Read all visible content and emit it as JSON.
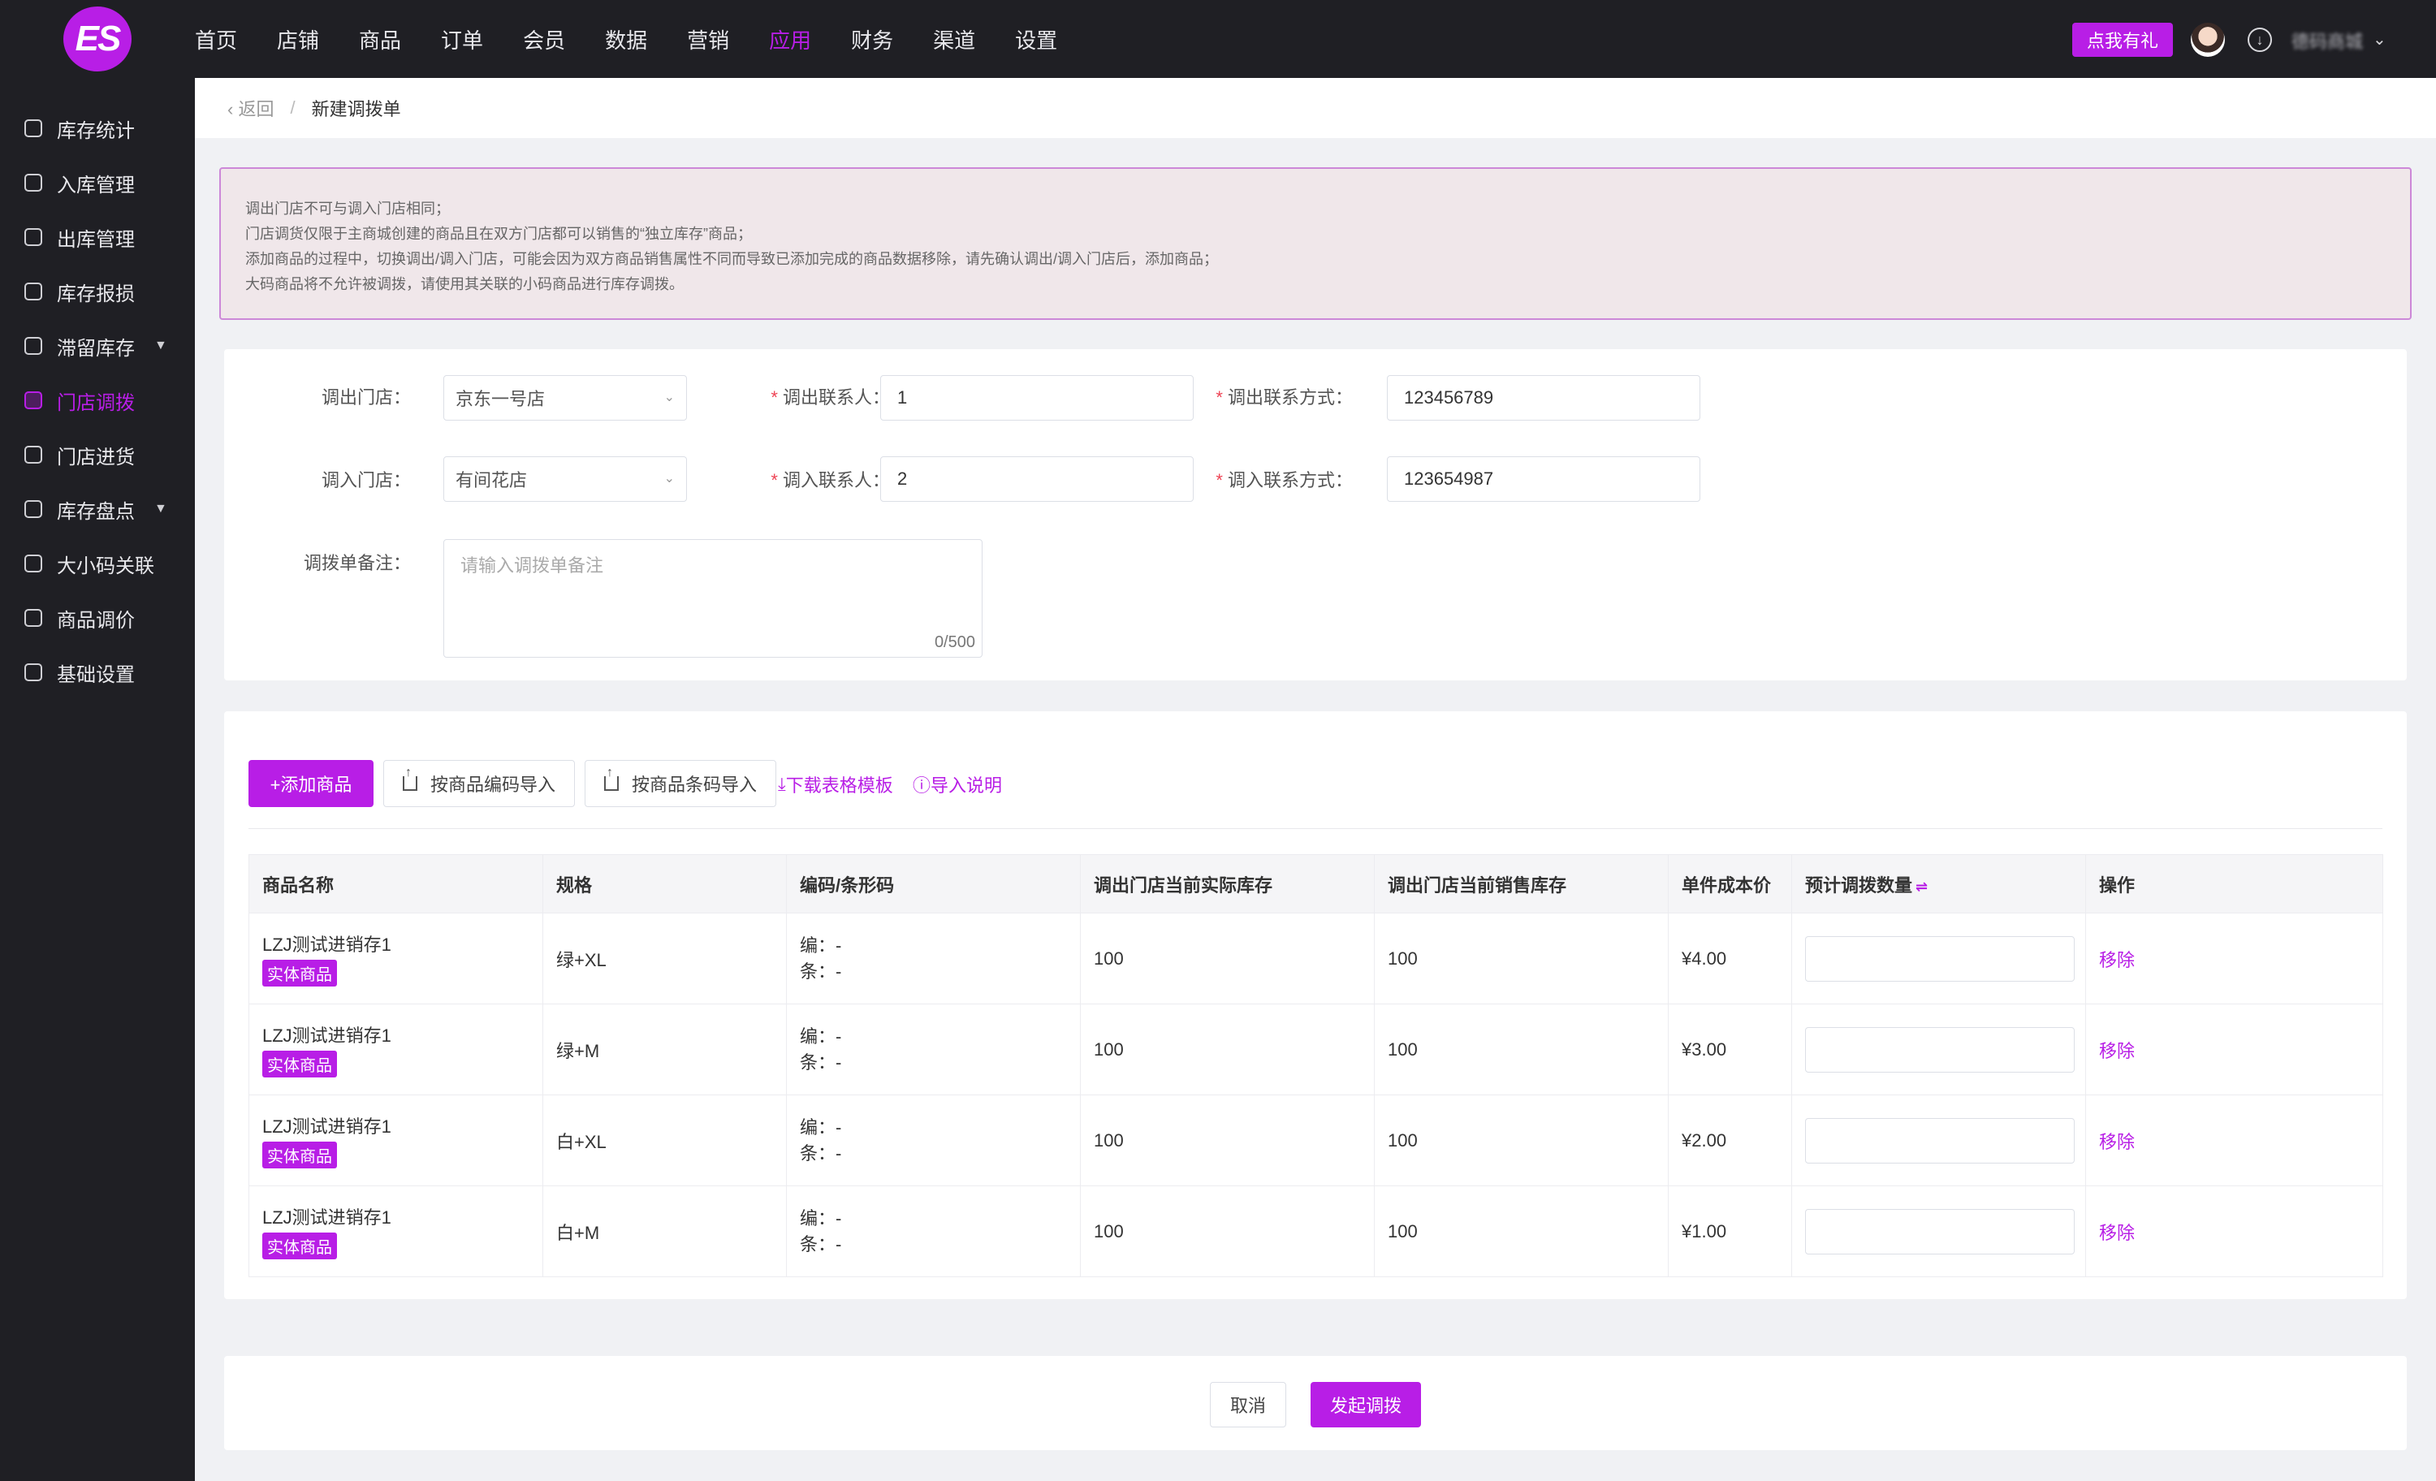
{
  "brand": {
    "logo_text": "ES"
  },
  "nav": {
    "items": [
      "首页",
      "店铺",
      "商品",
      "订单",
      "会员",
      "数据",
      "营销",
      "应用",
      "财务",
      "渠道",
      "设置"
    ],
    "active_index": 7,
    "accent": "#b81ee6"
  },
  "header": {
    "promo_label": "点我有礼",
    "username": "德码商城"
  },
  "sidebar": {
    "items": [
      {
        "label": "库存统计",
        "icon": "chart-icon"
      },
      {
        "label": "入库管理",
        "icon": "inbound-icon"
      },
      {
        "label": "出库管理",
        "icon": "outbound-icon"
      },
      {
        "label": "库存报损",
        "icon": "loss-icon"
      },
      {
        "label": "滞留库存",
        "icon": "stagnant-icon",
        "expandable": true
      },
      {
        "label": "门店调拨",
        "icon": "transfer-icon",
        "active": true
      },
      {
        "label": "门店进货",
        "icon": "cart-icon"
      },
      {
        "label": "库存盘点",
        "icon": "stocktake-icon",
        "expandable": true
      },
      {
        "label": "大小码关联",
        "icon": "link-icon"
      },
      {
        "label": "商品调价",
        "icon": "price-icon"
      },
      {
        "label": "基础设置",
        "icon": "settings-icon"
      }
    ]
  },
  "breadcrumb": {
    "back": "返回",
    "separator": "/",
    "current": "新建调拨单"
  },
  "notice": {
    "lines": [
      "调出门店不可与调入门店相同；",
      "门店调货仅限于主商城创建的商品且在双方门店都可以销售的“独立库存”商品；",
      "添加商品的过程中，切换调出/调入门店，可能会因为双方商品销售属性不同而导致已添加完成的商品数据移除，请先确认调出/调入门店后，添加商品；",
      "大码商品将不允许被调拨，请使用其关联的小码商品进行库存调拨。"
    ]
  },
  "form": {
    "out_store_label": "调出门店：",
    "out_store_value": "京东一号店",
    "out_contact_label": "调出联系人：",
    "out_contact_value": "1",
    "out_phone_label": "调出联系方式：",
    "out_phone_value": "123456789",
    "in_store_label": "调入门店：",
    "in_store_value": "有间花店",
    "in_contact_label": "调入联系人：",
    "in_contact_value": "2",
    "in_phone_label": "调入联系方式：",
    "in_phone_value": "123654987",
    "remark_label": "调拨单备注：",
    "remark_placeholder": "请输入调拨单备注",
    "remark_counter": "0/500",
    "required_mark": "*"
  },
  "toolbar": {
    "add_label": "+添加商品",
    "import_code_label": "按商品编码导入",
    "import_barcode_label": "按商品条码导入",
    "download_label": "下载表格模板",
    "help_label": "导入说明"
  },
  "table": {
    "columns": [
      "商品名称",
      "规格",
      "编码/条形码",
      "调出门店当前实际库存",
      "调出门店当前销售库存",
      "单件成本价",
      "预计调拨数量",
      "操作"
    ],
    "code_prefix": "编：",
    "barcode_prefix": "条：",
    "rows": [
      {
        "name": "LZJ测试进销存1",
        "tag": "实体商品",
        "spec": "绿+XL",
        "code": "-",
        "barcode": "-",
        "actual_stock": "100",
        "sale_stock": "100",
        "cost": "¥4.00",
        "action": "移除"
      },
      {
        "name": "LZJ测试进销存1",
        "tag": "实体商品",
        "spec": "绿+M",
        "code": "-",
        "barcode": "-",
        "actual_stock": "100",
        "sale_stock": "100",
        "cost": "¥3.00",
        "action": "移除"
      },
      {
        "name": "LZJ测试进销存1",
        "tag": "实体商品",
        "spec": "白+XL",
        "code": "-",
        "barcode": "-",
        "actual_stock": "100",
        "sale_stock": "100",
        "cost": "¥2.00",
        "action": "移除"
      },
      {
        "name": "LZJ测试进销存1",
        "tag": "实体商品",
        "spec": "白+M",
        "code": "-",
        "barcode": "-",
        "actual_stock": "100",
        "sale_stock": "100",
        "cost": "¥1.00",
        "action": "移除"
      }
    ]
  },
  "footer": {
    "cancel_label": "取消",
    "submit_label": "发起调拨"
  }
}
